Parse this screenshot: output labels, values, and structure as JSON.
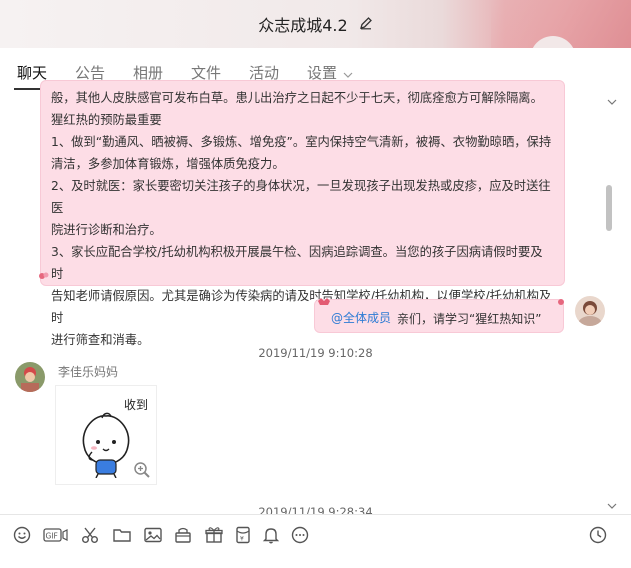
{
  "window": {
    "title": "众志成城4.2"
  },
  "tabs": [
    {
      "label": "聊天",
      "active": true
    },
    {
      "label": "公告"
    },
    {
      "label": "相册"
    },
    {
      "label": "文件"
    },
    {
      "label": "活动"
    },
    {
      "label": "设置"
    }
  ],
  "messages": {
    "notice": {
      "cut_line": "般，其他人皮肤感官可发布白草。患儿出治疗之日起不少于七天，彻底痊愈方可解除隔离。",
      "heading": "猩红热的预防最重要",
      "lines": [
        "1、做到“勤通风、晒被褥、多锻炼、增免疫”。室内保持空气清新，被褥、衣物勤晾晒，保持",
        "清洁，多参加体育锻炼，增强体质免疫力。",
        "2、及时就医：家长要密切关注孩子的身体状况，一旦发现孩子出现发热或皮疹，应及时送往医",
        "院进行诊断和治疗。",
        "3、家长应配合学校/托幼机构积极开展晨午检、因病追踪调查。当您的孩子因病请假时要及时",
        "告知老师请假原因。尤其是确诊为传染病的请及时告知学校/托幼机构，以便学校/托幼机构及时",
        "进行筛查和消毒。"
      ]
    },
    "self_message": {
      "mention": "@全体成员",
      "text": "亲们，请学习“猩红热知识”"
    },
    "timestamp1": "2019/11/19 9:10:28",
    "sender": "李佳乐妈妈",
    "sticker_text": "收到",
    "timestamp2": "2019/11/19 9:28:34"
  },
  "toolbar": {
    "gif_label": "GIF",
    "icons": [
      "emoji-icon",
      "gif-icon",
      "scissors-icon",
      "folder-icon",
      "image-icon",
      "gift-bag-icon",
      "gift-icon",
      "red-packet-icon",
      "bell-icon",
      "more-icon",
      "history-clock-icon"
    ]
  },
  "colors": {
    "bubble": "#fddde6",
    "mention": "#2d7bd4",
    "header_accent": "#e8b3b6"
  }
}
